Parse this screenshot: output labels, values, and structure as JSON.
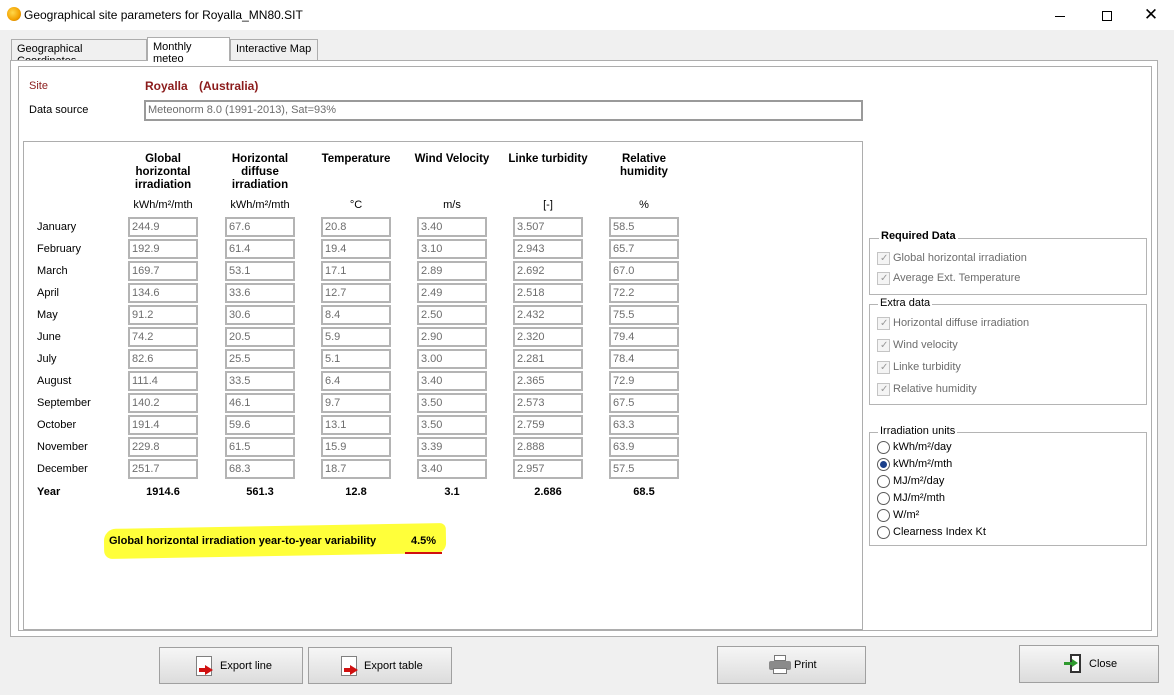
{
  "window": {
    "title": "Geographical site parameters for Royalla_MN80.SIT",
    "icon": "sun-globe-icon"
  },
  "tabs": [
    {
      "label": "Geographical Coordinates",
      "active": false
    },
    {
      "label": "Monthly meteo",
      "active": true
    },
    {
      "label": "Interactive Map",
      "active": false
    }
  ],
  "site": {
    "label": "Site",
    "name": "Royalla",
    "country": "(Australia)",
    "data_source_label": "Data source",
    "data_source_value": "Meteonorm 8.0 (1991-2013), Sat=93%"
  },
  "table": {
    "columns": [
      {
        "header": [
          "Global",
          "horizontal",
          "irradiation"
        ],
        "unit": "kWh/m²/mth"
      },
      {
        "header": [
          "Horizontal",
          "diffuse",
          "irradiation"
        ],
        "unit": "kWh/m²/mth"
      },
      {
        "header": [
          "Temperature"
        ],
        "unit": "°C"
      },
      {
        "header": [
          "Wind Velocity"
        ],
        "unit": "m/s"
      },
      {
        "header": [
          "Linke turbidity"
        ],
        "unit": "[-]"
      },
      {
        "header": [
          "Relative",
          "humidity"
        ],
        "unit": "%"
      }
    ],
    "rows": [
      {
        "month": "January",
        "values": [
          "244.9",
          "67.6",
          "20.8",
          "3.40",
          "3.507",
          "58.5"
        ]
      },
      {
        "month": "February",
        "values": [
          "192.9",
          "61.4",
          "19.4",
          "3.10",
          "2.943",
          "65.7"
        ]
      },
      {
        "month": "March",
        "values": [
          "169.7",
          "53.1",
          "17.1",
          "2.89",
          "2.692",
          "67.0"
        ]
      },
      {
        "month": "April",
        "values": [
          "134.6",
          "33.6",
          "12.7",
          "2.49",
          "2.518",
          "72.2"
        ]
      },
      {
        "month": "May",
        "values": [
          "91.2",
          "30.6",
          "8.4",
          "2.50",
          "2.432",
          "75.5"
        ]
      },
      {
        "month": "June",
        "values": [
          "74.2",
          "20.5",
          "5.9",
          "2.90",
          "2.320",
          "79.4"
        ]
      },
      {
        "month": "July",
        "values": [
          "82.6",
          "25.5",
          "5.1",
          "3.00",
          "2.281",
          "78.4"
        ]
      },
      {
        "month": "August",
        "values": [
          "111.4",
          "33.5",
          "6.4",
          "3.40",
          "2.365",
          "72.9"
        ]
      },
      {
        "month": "September",
        "values": [
          "140.2",
          "46.1",
          "9.7",
          "3.50",
          "2.573",
          "67.5"
        ]
      },
      {
        "month": "October",
        "values": [
          "191.4",
          "59.6",
          "13.1",
          "3.50",
          "2.759",
          "63.3"
        ]
      },
      {
        "month": "November",
        "values": [
          "229.8",
          "61.5",
          "15.9",
          "3.39",
          "2.888",
          "63.9"
        ]
      },
      {
        "month": "December",
        "values": [
          "251.7",
          "68.3",
          "18.7",
          "3.40",
          "2.957",
          "57.5"
        ]
      }
    ],
    "year": {
      "label": "Year",
      "values": [
        "1914.6",
        "561.3",
        "12.8",
        "3.1",
        "2.686",
        "68.5"
      ]
    }
  },
  "variability": {
    "text": "Global horizontal irradiation year-to-year variability",
    "value": "4.5%",
    "highlight_color": "#ffff3a",
    "underline_color": "#d01010"
  },
  "required_data": {
    "title": "Required Data",
    "items": [
      {
        "label": "Global horizontal irradiation",
        "checked": true
      },
      {
        "label": "Average Ext. Temperature",
        "checked": true
      }
    ]
  },
  "extra_data": {
    "title": "Extra data",
    "items": [
      {
        "label": "Horizontal diffuse irradiation",
        "checked": true
      },
      {
        "label": "Wind velocity",
        "checked": true
      },
      {
        "label": "Linke turbidity",
        "checked": true
      },
      {
        "label": "Relative humidity",
        "checked": true
      }
    ]
  },
  "irradiation_units": {
    "title": "Irradiation units",
    "options": [
      {
        "label": "kWh/m²/day",
        "selected": false
      },
      {
        "label": "kWh/m²/mth",
        "selected": true
      },
      {
        "label": "MJ/m²/day",
        "selected": false
      },
      {
        "label": "MJ/m²/mth",
        "selected": false
      },
      {
        "label": "W/m²",
        "selected": false
      },
      {
        "label": "Clearness Index Kt",
        "selected": false
      }
    ]
  },
  "buttons": {
    "export_line": "Export line",
    "export_table": "Export table",
    "print": "Print",
    "close": "Close"
  },
  "colors": {
    "site_text": "#8b1b1b",
    "radio_selected": "#1a3f8a"
  }
}
